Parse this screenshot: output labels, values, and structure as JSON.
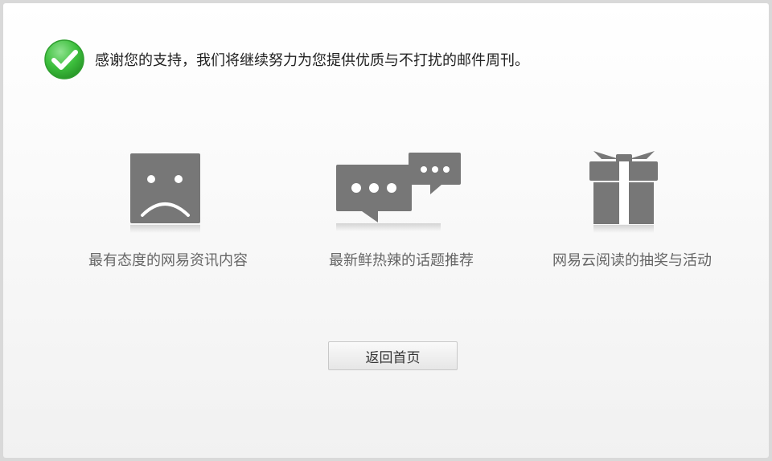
{
  "message": "感谢您的支持，我们将继续努力为您提供优质与不打扰的邮件周刊。",
  "features": [
    {
      "label": "最有态度的网易资讯内容",
      "icon": "sad-face-icon"
    },
    {
      "label": "最新鲜热辣的话题推荐",
      "icon": "chat-bubbles-icon"
    },
    {
      "label": "网易云阅读的抽奖与活动",
      "icon": "gift-icon"
    }
  ],
  "back_button": "返回首页",
  "colors": {
    "check_green": "#3dbf3d",
    "icon_gray": "#777777",
    "caption_gray": "#666666"
  }
}
